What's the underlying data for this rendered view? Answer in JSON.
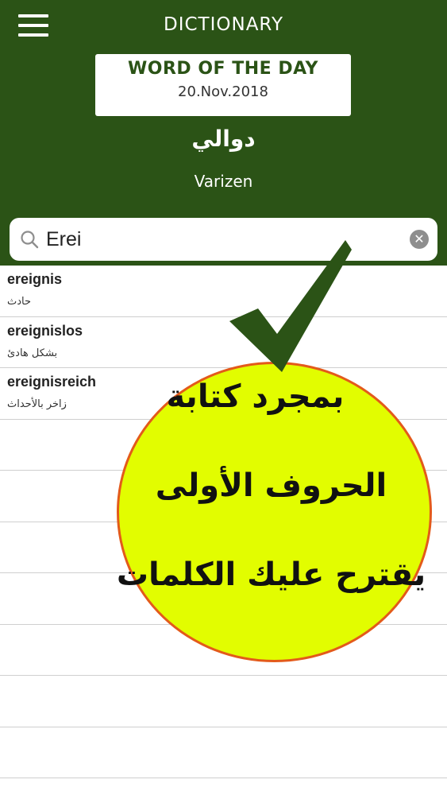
{
  "header": {
    "title": "DICTIONARY",
    "menu_icon": "hamburger-menu-icon"
  },
  "word_of_the_day": {
    "heading": "WORD OF THE DAY",
    "date": "20.Nov.2018",
    "word": "دوالي",
    "translation": "Varizen"
  },
  "search": {
    "value": "Erei",
    "search_icon": "search-icon",
    "clear_icon": "clear-icon"
  },
  "results": [
    {
      "word": "ereignis",
      "translation": "حادث"
    },
    {
      "word": "ereignislos",
      "translation": "بشكل هادئ"
    },
    {
      "word": "ereignisreich",
      "translation": "زاخر بالأحداث"
    },
    {
      "word": "",
      "translation": ""
    },
    {
      "word": "",
      "translation": ""
    },
    {
      "word": "",
      "translation": ""
    },
    {
      "word": "",
      "translation": ""
    },
    {
      "word": "",
      "translation": ""
    },
    {
      "word": "",
      "translation": ""
    },
    {
      "word": "",
      "translation": ""
    }
  ],
  "promo": {
    "line1": "بمجرد كتابة",
    "line2": "الحروف الأولى",
    "line3": "يقترح عليك الكلمات",
    "circle_color": "#e2fd00",
    "check_color": "#2b5316"
  },
  "colors": {
    "brand_green": "#2b5316"
  }
}
